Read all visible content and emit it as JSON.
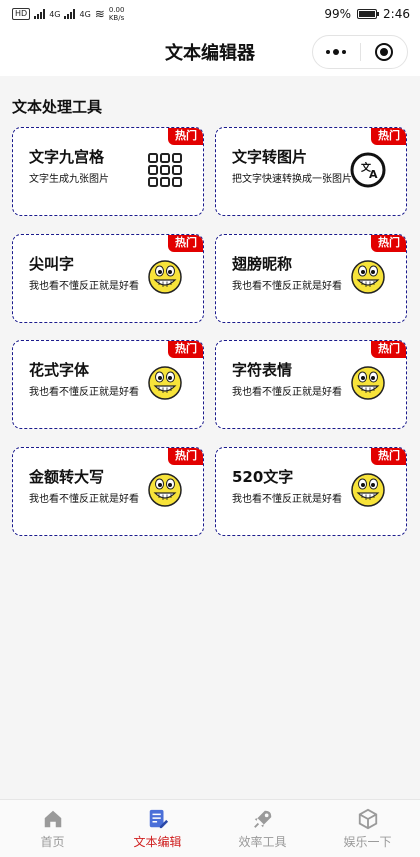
{
  "status_bar": {
    "left_items": [
      "HD",
      "4G",
      "4G"
    ],
    "network_speed": "0.00 KB/s",
    "battery": "99%",
    "time": "2:46"
  },
  "nav": {
    "title": "文本编辑器"
  },
  "section": {
    "title": "文本处理工具"
  },
  "cards": [
    {
      "title": "文字九宫格",
      "desc": "文字生成九张图片",
      "badge": "热门",
      "icon": "grid-icon"
    },
    {
      "title": "文字转图片",
      "desc": "把文字快速转换成一张图片",
      "badge": "热门",
      "icon": "translate-icon"
    },
    {
      "title": "尖叫字",
      "desc": "我也看不懂反正就是好看",
      "badge": "热门",
      "icon": "grin-emoji-icon"
    },
    {
      "title": "翅膀昵称",
      "desc": "我也看不懂反正就是好看",
      "badge": "热门",
      "icon": "grin-emoji-icon"
    },
    {
      "title": "花式字体",
      "desc": "我也看不懂反正就是好看",
      "badge": "热门",
      "icon": "grin-emoji-icon"
    },
    {
      "title": "字符表情",
      "desc": "我也看不懂反正就是好看",
      "badge": "热门",
      "icon": "grin-emoji-icon"
    },
    {
      "title": "金额转大写",
      "desc": "我也看不懂反正就是好看",
      "badge": "热门",
      "icon": "grin-emoji-icon"
    },
    {
      "title": "520文字",
      "desc": "我也看不懂反正就是好看",
      "badge": "热门",
      "icon": "grin-emoji-icon"
    }
  ],
  "tabbar": {
    "active_color": "#d02020",
    "items": [
      {
        "label": "首页",
        "icon": "home-icon"
      },
      {
        "label": "文本编辑",
        "icon": "edit-doc-icon"
      },
      {
        "label": "效率工具",
        "icon": "rocket-icon"
      },
      {
        "label": "娱乐一下",
        "icon": "cube-icon"
      }
    ]
  }
}
